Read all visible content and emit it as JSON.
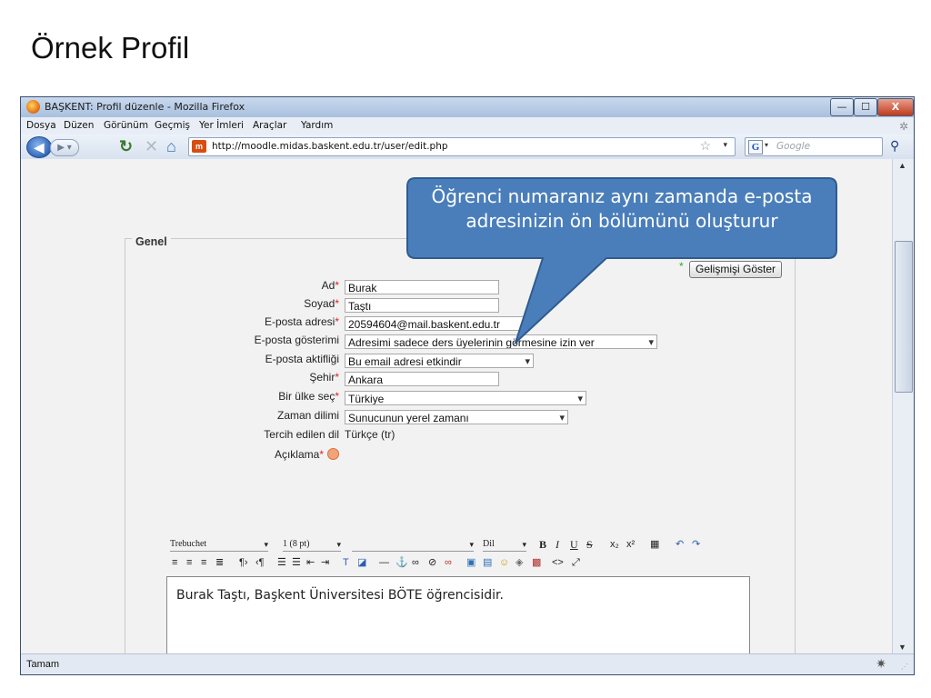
{
  "slide": {
    "title": "Örnek Profil"
  },
  "window": {
    "title": "BAŞKENT: Profil düzenle - Mozilla Firefox",
    "controls": {
      "minimize": "—",
      "maximize": "☐",
      "close": "X"
    }
  },
  "menu": [
    {
      "label": "Dosya"
    },
    {
      "label": "Düzen"
    },
    {
      "label": "Görünüm"
    },
    {
      "label": "Geçmiş"
    },
    {
      "label": "Yer İmleri"
    },
    {
      "label": "Araçlar"
    },
    {
      "label": "Yardım"
    }
  ],
  "nav": {
    "url": "http://moodle.midas.baskent.edu.tr/user/edit.php",
    "search_placeholder": "Google"
  },
  "form": {
    "section_title": "Genel",
    "advanced_button": "Gelişmişi Göster",
    "advanced_star": "*",
    "fields": {
      "ad": {
        "label": "Ad",
        "value": "Burak"
      },
      "soyad": {
        "label": "Soyad",
        "value": "Taştı"
      },
      "email": {
        "label": "E-posta adresi",
        "value": "20594604@mail.baskent.edu.tr"
      },
      "email_display": {
        "label": "E-posta gösterimi",
        "value": "Adresimi sadece ders üyelerinin görmesine izin ver"
      },
      "email_active": {
        "label": "E-posta aktifliği",
        "value": "Bu email adresi etkindir"
      },
      "city": {
        "label": "Şehir",
        "value": "Ankara"
      },
      "country": {
        "label": "Bir ülke seç",
        "value": "Türkiye"
      },
      "timezone": {
        "label": "Zaman dilimi",
        "value": "Sunucunun yerel zamanı"
      },
      "language": {
        "label": "Tercih edilen dil",
        "value": "Türkçe (tr)"
      },
      "description": {
        "label": "Açıklama"
      }
    },
    "required_mark": "*"
  },
  "editor": {
    "font": "Trebuchet",
    "size": "1 (8 pt)",
    "lang": "Dil",
    "content": "Burak Taştı, Başkent Üniversitesi BÖTE öğrencisidir."
  },
  "callout": {
    "line1": "Öğrenci numaranız aynı zamanda e-posta",
    "line2": "adresinizin ön bölümünü oluşturur",
    "fill": "#4a7ebb",
    "stroke": "#2f5b8f"
  },
  "status": {
    "text": "Tamam"
  }
}
